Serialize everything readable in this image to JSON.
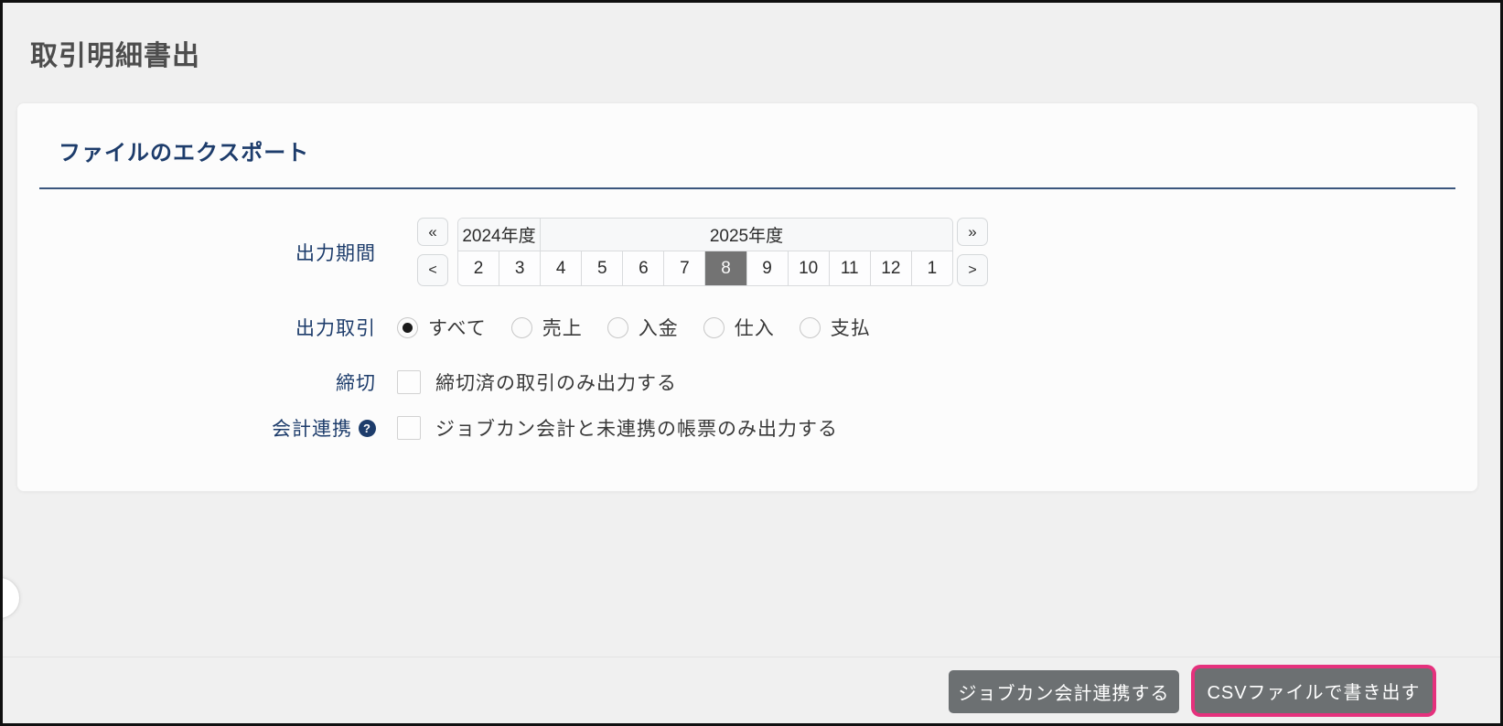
{
  "page_title": "取引明細書出",
  "card": {
    "heading": "ファイルのエクスポート",
    "period": {
      "label": "出力期間",
      "prev_year_icon": "«",
      "next_year_icon": "»",
      "prev_month_icon": "<",
      "next_month_icon": ">",
      "years": [
        {
          "label": "2024年度"
        },
        {
          "label": "2025年度"
        }
      ],
      "months": [
        "2",
        "3",
        "4",
        "5",
        "6",
        "7",
        "8",
        "9",
        "10",
        "11",
        "12",
        "1"
      ],
      "selected_month": "8"
    },
    "transaction": {
      "label": "出力取引",
      "options": [
        {
          "label": "すべて",
          "selected": true
        },
        {
          "label": "売上",
          "selected": false
        },
        {
          "label": "入金",
          "selected": false
        },
        {
          "label": "仕入",
          "selected": false
        },
        {
          "label": "支払",
          "selected": false
        }
      ]
    },
    "deadline": {
      "label": "締切",
      "checkbox_label": "締切済の取引のみ出力する",
      "checked": false
    },
    "accounting": {
      "label": "会計連携",
      "help_icon": "?",
      "checkbox_label": "ジョブカン会計と未連携の帳票のみ出力する",
      "checked": false
    }
  },
  "footer": {
    "accounting_link_button": "ジョブカン会計連携する",
    "csv_export_button": "CSVファイルで書き出す"
  },
  "colors": {
    "accent_pink": "#e5317d",
    "navy": "#1d3c6b",
    "button_gray": "#6c7072",
    "selected_month_bg": "#737373",
    "background": "#f0f0f0"
  }
}
